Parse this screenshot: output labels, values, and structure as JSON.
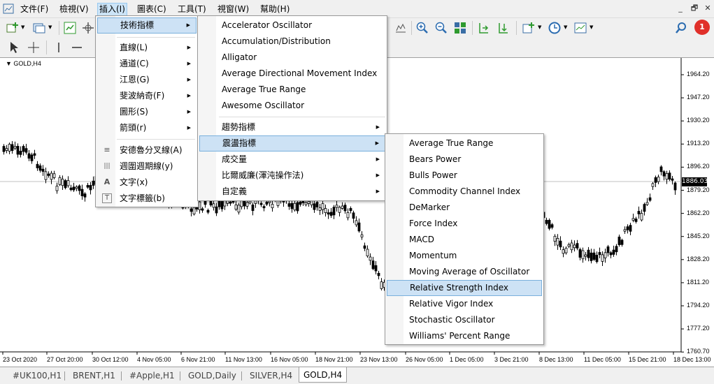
{
  "menubar": {
    "items": [
      "文件(F)",
      "檢視(V)",
      "插入(I)",
      "圖表(C)",
      "工具(T)",
      "視窗(W)",
      "幫助(H)"
    ]
  },
  "window_controls": {
    "minimize": "_",
    "restore": "🗗",
    "close": "✕"
  },
  "notification_badge": "1",
  "chart": {
    "title": "GOLD,H4",
    "current_price": "1886.03",
    "y_ticks": [
      "1964.20",
      "1947.20",
      "1930.20",
      "1913.20",
      "1896.20",
      "1879.20",
      "1862.20",
      "1845.20",
      "1828.20",
      "1811.20",
      "1794.20",
      "1777.20",
      "1760.70"
    ],
    "x_ticks": [
      "23 Oct 2020",
      "27 Oct 20:00",
      "30 Oct 12:00",
      "4 Nov 05:00",
      "6 Nov 21:00",
      "11 Nov 13:00",
      "16 Nov 05:00",
      "18 Nov 21:00",
      "23 Nov 13:00",
      "26 Nov 05:00",
      "1 Dec 05:00",
      "3 Dec 21:00",
      "8 Dec 13:00",
      "11 Dec 05:00",
      "15 Dec 21:00",
      "18 Dec 13:00"
    ]
  },
  "insert_menu": {
    "items": [
      {
        "label": "技術指標",
        "arrow": "▶"
      },
      {
        "label": "直線(L)",
        "arrow": "▶"
      },
      {
        "label": "通道(C)",
        "arrow": "▶"
      },
      {
        "label": "江恩(G)",
        "arrow": "▶"
      },
      {
        "label": "斐波納奇(F)",
        "arrow": "▶"
      },
      {
        "label": "圖形(S)",
        "arrow": "▶"
      },
      {
        "label": "箭頭(r)",
        "arrow": "▶"
      },
      {
        "label": "安德魯分叉線(A)",
        "icon": "≡"
      },
      {
        "label": "週圍週期線(y)",
        "icon": "|||"
      },
      {
        "label": "文字(x)",
        "icon": "A"
      },
      {
        "label": "文字標籤(b)",
        "icon": "T"
      }
    ]
  },
  "indicators_menu": {
    "items": [
      "Accelerator Oscillator",
      "Accumulation/Distribution",
      "Alligator",
      "Average Directional Movement Index",
      "Average True Range",
      "Awesome Oscillator"
    ],
    "groups": [
      {
        "label": "趨勢指標",
        "arrow": "▶"
      },
      {
        "label": "震盪指標",
        "arrow": "▶"
      },
      {
        "label": "成交量",
        "arrow": "▶"
      },
      {
        "label": "比爾威廉(渾沌操作法)",
        "arrow": "▶"
      },
      {
        "label": "自定義",
        "arrow": "▶"
      }
    ]
  },
  "oscillators_menu": {
    "items": [
      "Average True Range",
      "Bears Power",
      "Bulls Power",
      "Commodity Channel Index",
      "DeMarker",
      "Force Index",
      "MACD",
      "Momentum",
      "Moving Average of Oscillator",
      "Relative Strength Index",
      "Relative Vigor Index",
      "Stochastic Oscillator",
      "Williams' Percent Range"
    ]
  },
  "tabs": [
    "#UK100,H1",
    "BRENT,H1",
    "#Apple,H1",
    "GOLD,Daily",
    "SILVER,H4",
    "GOLD,H4"
  ],
  "colors": {
    "selected": "#cde2f5",
    "menu_active": "#cce4f7",
    "badge": "#e0302a"
  }
}
